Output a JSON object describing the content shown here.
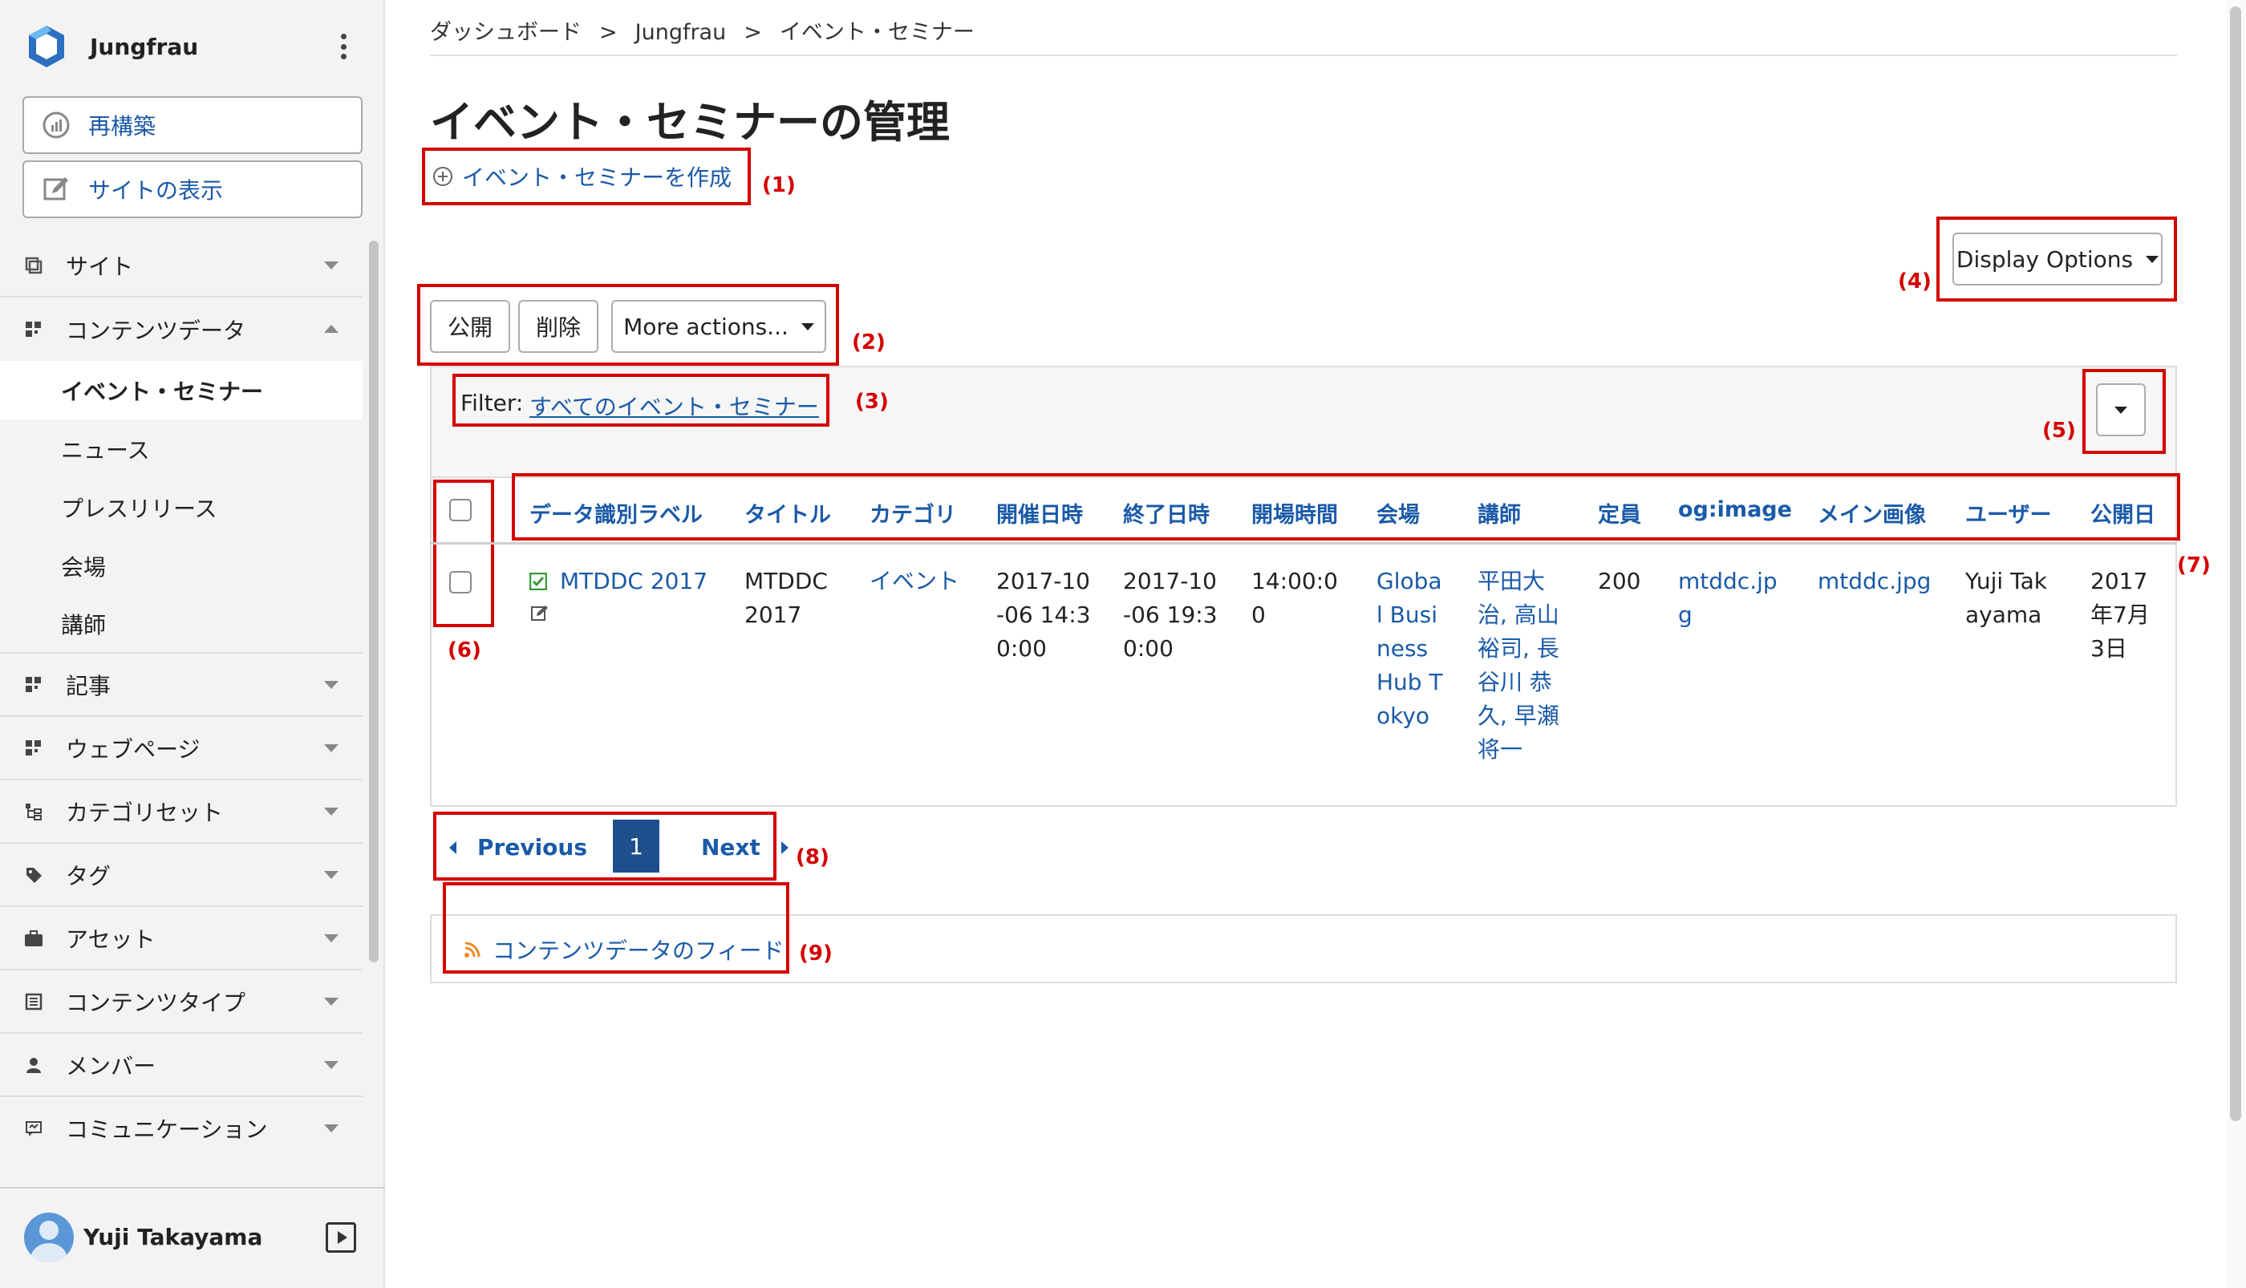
{
  "sidebar": {
    "site_name": "Jungfrau",
    "rebuild_label": "再構築",
    "view_site_label": "サイトの表示",
    "nav": [
      {
        "label": "サイト",
        "icon": "site-icon"
      },
      {
        "label": "コンテンツデータ",
        "icon": "content-data-icon",
        "expanded": true,
        "children": [
          "イベント・セミナー",
          "ニュース",
          "プレスリリース",
          "会場",
          "講師"
        ]
      },
      {
        "label": "記事",
        "icon": "entries-icon"
      },
      {
        "label": "ウェブページ",
        "icon": "pages-icon"
      },
      {
        "label": "カテゴリセット",
        "icon": "category-set-icon"
      },
      {
        "label": "タグ",
        "icon": "tag-icon"
      },
      {
        "label": "アセット",
        "icon": "asset-icon"
      },
      {
        "label": "コンテンツタイプ",
        "icon": "content-type-icon"
      },
      {
        "label": "メンバー",
        "icon": "member-icon"
      },
      {
        "label": "コミュニケーション",
        "icon": "communication-icon"
      }
    ],
    "active_child": "イベント・セミナー",
    "user_name": "Yuji Takayama"
  },
  "breadcrumb": [
    "ダッシュボード",
    "Jungfrau",
    "イベント・セミナー"
  ],
  "page_title": "イベント・セミナーの管理",
  "create_link": "イベント・セミナーを作成",
  "actions": {
    "publish": "公開",
    "delete": "削除",
    "more": "More actions..."
  },
  "display_options": "Display Options",
  "filter": {
    "label": "Filter:",
    "value": "すべてのイベント・セミナー"
  },
  "table": {
    "columns": [
      "データ識別ラベル",
      "タイトル",
      "カテゴリ",
      "開催日時",
      "終了日時",
      "開場時間",
      "会場",
      "講師",
      "定員",
      "og:image",
      "メイン画像",
      "ユーザー",
      "公開日"
    ],
    "rows": [
      {
        "label": "MTDDC 2017",
        "title": [
          "MTDDC",
          "2017"
        ],
        "category": "イベント",
        "start": [
          "2017-10",
          "-06 14:3",
          "0:00"
        ],
        "end": [
          "2017-10",
          "-06 19:3",
          "0:00"
        ],
        "open": [
          "14:00:0",
          "0"
        ],
        "venue": [
          "Globa",
          "l Busi",
          "ness",
          "Hub T",
          "okyo"
        ],
        "speakers": [
          "平田大",
          "治, 高山",
          "裕司, 長",
          "谷川 恭",
          "久, 早瀬",
          "将一"
        ],
        "capacity": "200",
        "og_image": [
          "mtddc.jp",
          "g"
        ],
        "main_image": "mtddc.jpg",
        "user": [
          "Yuji Tak",
          "ayama"
        ],
        "published": [
          "2017",
          "年7月",
          "3日"
        ]
      }
    ]
  },
  "pager": {
    "prev": "Previous",
    "current": "1",
    "next": "Next"
  },
  "feed_link": "コンテンツデータのフィード",
  "annotations": [
    "(1)",
    "(2)",
    "(3)",
    "(4)",
    "(5)",
    "(6)",
    "(7)",
    "(8)",
    "(9)"
  ],
  "colors": {
    "link": "#1a5aa8",
    "annotation": "#d40000",
    "active_page": "#1e4f8c",
    "sidebar_bg": "#f3f3f3"
  }
}
